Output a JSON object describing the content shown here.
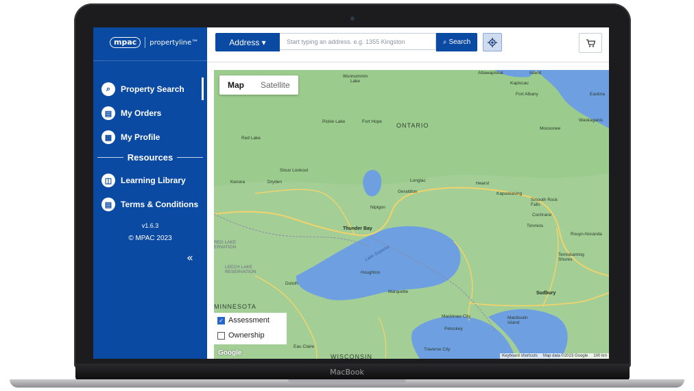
{
  "device": {
    "label": "MacBook"
  },
  "sidebar": {
    "logo_brand": "mpac",
    "logo_product": "propertyline™",
    "nav": [
      {
        "label": "Property Search",
        "icon": "search-icon"
      },
      {
        "label": "My Orders",
        "icon": "orders-icon"
      },
      {
        "label": "My Profile",
        "icon": "profile-icon"
      }
    ],
    "resources_heading": "Resources",
    "resources": [
      {
        "label": "Learning Library",
        "icon": "book-icon"
      },
      {
        "label": "Terms & Conditions",
        "icon": "document-icon"
      }
    ],
    "version": "v1.6.3",
    "copyright": "© MPAC 2023",
    "collapse_glyph": "«"
  },
  "topbar": {
    "address_label": "Address ▾",
    "search_placeholder": "Start typing an address. e.g. 1355 Kingston",
    "search_label": "Search"
  },
  "map": {
    "type_map": "Map",
    "type_satellite": "Satellite",
    "layers": [
      {
        "label": "Assessment",
        "checked": true
      },
      {
        "label": "Ownership",
        "checked": false
      }
    ],
    "labels": {
      "ontario": "ONTARIO",
      "minnesota": "MINNESOTA",
      "wisconsin": "WISCONSIN",
      "attawapiskat": "Attawapiskat",
      "island": "Island",
      "kapiscau": "Kapiscau",
      "fort_albany": "Fort Albany",
      "eastmain": "Eastma",
      "moosonee": "Moosonee",
      "waskaganish": "Waskaganis",
      "wunnummin": "Wunnummin Lake",
      "pickle_lake": "Pickle Lake",
      "fort_hope": "Fort Hope",
      "red_lake": "Red Lake",
      "sioux_lookout": "Sioux Lookout",
      "kenora": "Kenora",
      "dryden": "Dryden",
      "longlac": "Longlac",
      "geraldton": "Geraldton",
      "hearst": "Hearst",
      "kapuskasing": "Kapuskasing",
      "smooth_rock": "Smooth Rock Falls",
      "cochrane": "Cochrane",
      "timmins": "Timmins",
      "rouyn": "Rouyn-Noranda",
      "nipigon": "Nipigon",
      "thunder_bay": "Thunder Bay",
      "red_lake_res": "RED LAKE ERVATION",
      "leech_lake": "LEECH LAKE RESERVATION",
      "lake_superior": "Lake Superior",
      "temiskaming": "Temiskaming Shores",
      "houghton": "Houghton",
      "duluth": "Duluth",
      "marquette": "Marquette",
      "sudbury": "Sudbury",
      "mackinaw": "Mackinaw City",
      "petoskey": "Petoskey",
      "manitoulin": "Manitoulin Island",
      "eau_claire": "Eau Claire",
      "traverse": "Traverse City"
    },
    "attribution": {
      "shortcuts": "Keyboard shortcuts",
      "data": "Map data ©2023 Google",
      "scale": "100 km"
    },
    "google": "Google"
  },
  "colors": {
    "brand_blue": "#0b4aa2",
    "land": "#a3cf97",
    "water": "#6e9fe0",
    "roads": "#f2d36b"
  }
}
